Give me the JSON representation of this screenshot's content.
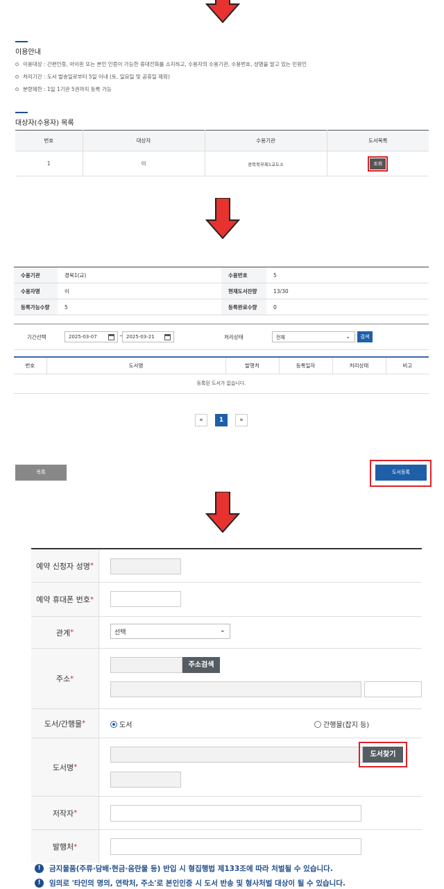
{
  "colors": {
    "arrow": "#e8322f",
    "accent": "#1f5fa8",
    "highlight": "#e01e26"
  },
  "section1": {
    "title": "이용안내",
    "items": [
      "이용대상 : 간편인증, 아이핀 또는 본인 인증이 가능한 휴대전화를 소지하고, 수용자의 수용기관, 수용번호, 성명을 알고 있는 민원인",
      "처리기간 : 도서 발송일로부터 5일 이내 (토, 일요일 및 공휴일 제외)",
      "분량제한 : 1일 1기관 5권까지 등록 가능"
    ],
    "list_title": "대상자(수용자) 목록",
    "headers": [
      "번호",
      "대상자",
      "수용기관",
      "도서목록"
    ],
    "row": {
      "no": "1",
      "name": "이",
      "org": "경북북부제1교도소",
      "btn": "조회"
    }
  },
  "section2": {
    "info": [
      {
        "label": "수용기관",
        "value": "경북1(교)",
        "label2": "수용번호",
        "value2": "5"
      },
      {
        "label": "수용자명",
        "value": "이",
        "label2": "현재도서잔량",
        "value2": "13/30"
      },
      {
        "label": "등록가능수량",
        "value": "5",
        "label2": "등록완료수량",
        "value2": "0"
      }
    ],
    "period_label": "기간선택",
    "date_from": "2025-03-07",
    "tilde": "~",
    "date_to": "2025-03-21",
    "status_label": "처리상태",
    "status_value": "전체",
    "search": "검색",
    "headers": [
      "번호",
      "도서명",
      "발행처",
      "등록일자",
      "처리상태",
      "비고"
    ],
    "empty": "등록된 도서가 없습니다.",
    "pager": {
      "prev": "«",
      "page": "1",
      "next": "»"
    },
    "list_btn": "목록",
    "register_btn": "도서등록"
  },
  "section3": {
    "labels": {
      "name": "예약 신청자 성명",
      "phone": "예약 휴대폰 번호",
      "relation": "관계",
      "address": "주소",
      "type": "도서/간행물",
      "book": "도서명",
      "author": "저작자",
      "publisher": "발행처"
    },
    "req": "*",
    "relation_value": "선택",
    "address_btn": "주소검색",
    "radio_book": "도서",
    "radio_periodical": "간행물(잡지 등)",
    "find_btn": "도서찾기",
    "notices": [
      "금지물품(주류·담배·현금·음란물 등) 반입 시 형집행법 제133조에 따라 처벌될 수 있습니다.",
      "임의로 '타인의 명의, 연락처, 주소'로 본인인증 시 도서 반송 및 형사처벌 대상이 될 수 있습니다."
    ],
    "notice_icon": "!"
  }
}
